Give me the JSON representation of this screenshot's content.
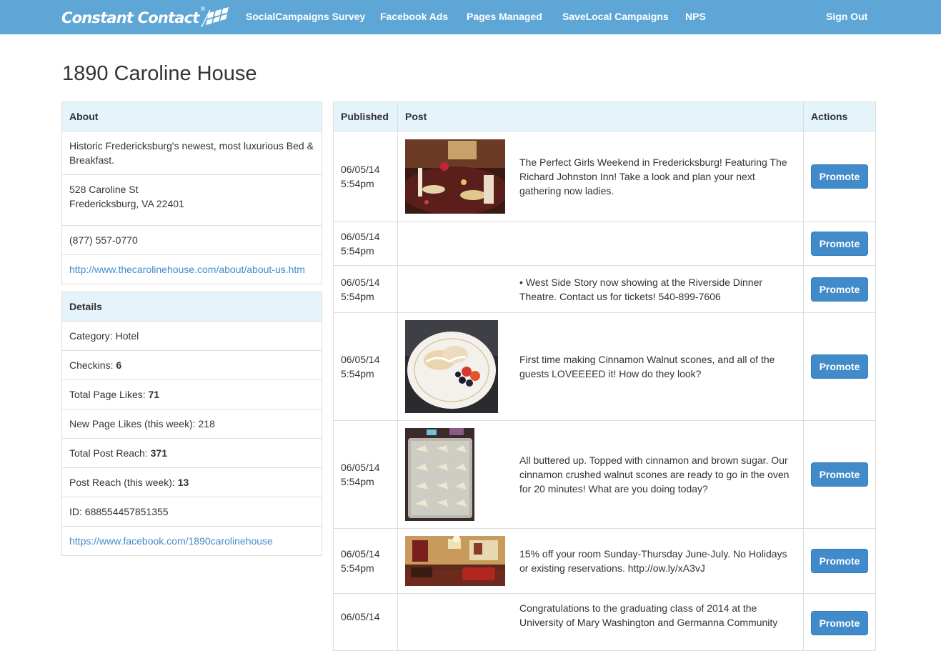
{
  "brand": {
    "name": "Constant Contact",
    "mark": "®"
  },
  "nav": {
    "items": [
      "SocialCampaigns Survey",
      "Facebook Ads",
      "Pages Managed",
      "SaveLocal Campaigns",
      "NPS"
    ],
    "sign_out": "Sign Out"
  },
  "page_title": "1890 Caroline House",
  "about": {
    "heading": "About",
    "description": "Historic Fredericksburg's newest, most luxurious Bed & Breakfast.",
    "address_line1": "528 Caroline St",
    "address_line2": "Fredericksburg, VA 22401",
    "phone": "(877) 557-0770",
    "website": "http://www.thecarolinehouse.com/about/about-us.htm"
  },
  "details": {
    "heading": "Details",
    "category_label": "Category: Hotel",
    "checkins_label": "Checkins:",
    "checkins_value": "6",
    "total_likes_label": "Total Page Likes:",
    "total_likes_value": "71",
    "new_likes_label": "New Page Likes (this week): 218",
    "total_reach_label": "Total Post Reach:",
    "total_reach_value": "371",
    "week_reach_label": "Post Reach (this week):",
    "week_reach_value": "13",
    "id_label": "ID: 688554457851355",
    "facebook_url": "https://www.facebook.com/1890carolinehouse"
  },
  "posts": {
    "headers": {
      "published": "Published",
      "post": "Post",
      "actions": "Actions"
    },
    "promote_label": "Promote",
    "rows": [
      {
        "date": "06/05/14",
        "time": "5:54pm",
        "image": "dining-table-photo",
        "text": "The Perfect Girls Weekend in Fredericksburg! Featuring The Richard Johnston Inn! Take a look and plan your next gathering now ladies."
      },
      {
        "date": "06/05/14",
        "time": "5:54pm",
        "image": "",
        "text": ""
      },
      {
        "date": "06/05/14",
        "time": "5:54pm",
        "image": "",
        "text": "• West Side Story now showing at the Riverside Dinner Theatre. Contact us for tickets! 540-899-7606"
      },
      {
        "date": "06/05/14",
        "time": "5:54pm",
        "image": "scones-plate-photo",
        "text": "First time making Cinnamon Walnut scones, and all of the guests LOVEEEED it! How do they look?"
      },
      {
        "date": "06/05/14",
        "time": "5:54pm",
        "image": "scones-baking-tray-photo",
        "text": "All buttered up. Topped with cinnamon and brown sugar. Our cinnamon crushed walnut scones are ready to go in the oven for 20 minutes! What are you doing today?"
      },
      {
        "date": "06/05/14",
        "time": "5:54pm",
        "image": "living-room-photo",
        "text": "15% off your room Sunday-Thursday June-July. No Holidays or existing reservations. http://ow.ly/xA3vJ"
      },
      {
        "date": "06/05/14",
        "time": "",
        "image": "",
        "text": "Congratulations to the graduating class of 2014 at the University of Mary Washington and Germanna Community"
      }
    ]
  },
  "colors": {
    "navbar": "#5ea6d5",
    "panel_heading": "#e5f3fb",
    "link": "#428bca",
    "button": "#428bca"
  }
}
